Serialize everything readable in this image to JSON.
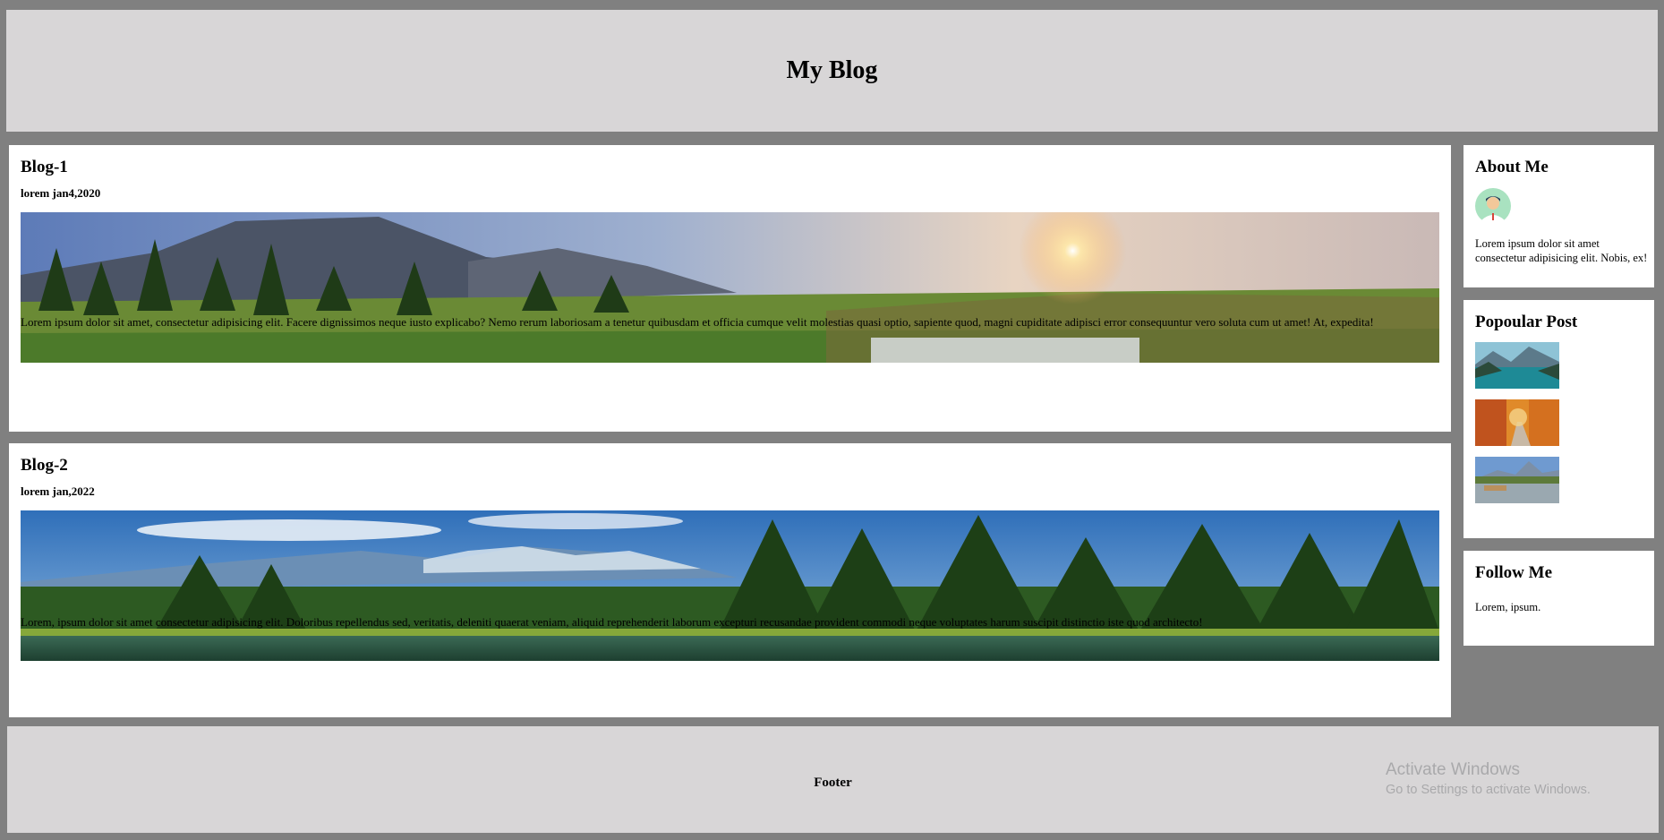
{
  "header": {
    "title": "My Blog"
  },
  "posts": [
    {
      "title": "Blog-1",
      "date": "lorem jan4,2020",
      "image": "mountain-sunrise-image",
      "text": "Lorem ipsum dolor sit amet, consectetur adipisicing elit. Facere dignissimos neque iusto explicabo? Nemo rerum laboriosam a tenetur quibusdam et officia cumque velit molestias quasi optio, sapiente quod, magni cupiditate adipisci error consequuntur vero soluta cum ut amet! At, expedita!"
    },
    {
      "title": "Blog-2",
      "date": "lorem jan,2022",
      "image": "forest-lake-image",
      "text": "Lorem, ipsum dolor sit amet consectetur adipisicing elit. Doloribus repellendus sed, veritatis, deleniti quaerat veniam, aliquid reprehenderit laborum excepturi recusandae provident commodi neque voluptates harum suscipit distinctio iste quod architecto!"
    }
  ],
  "sidebar": {
    "about": {
      "title": "About Me",
      "avatar_icon": "user-avatar-icon",
      "text": "Lorem ipsum dolor sit amet consectetur adipisicing elit. Nobis, ex!"
    },
    "popular": {
      "title": "Popoular Post",
      "thumbs": [
        "lake-thumbnail",
        "autumn-road-thumbnail",
        "mountain-reflection-thumbnail"
      ]
    },
    "follow": {
      "title": "Follow Me",
      "text": "Lorem, ipsum."
    }
  },
  "footer": {
    "text": "Footer"
  },
  "watermark": {
    "line1": "Activate Windows",
    "line2": "Go to Settings to activate Windows."
  },
  "colors": {
    "page_bg": "#808080",
    "band_bg": "#d8d6d7",
    "card_bg": "#ffffff"
  }
}
